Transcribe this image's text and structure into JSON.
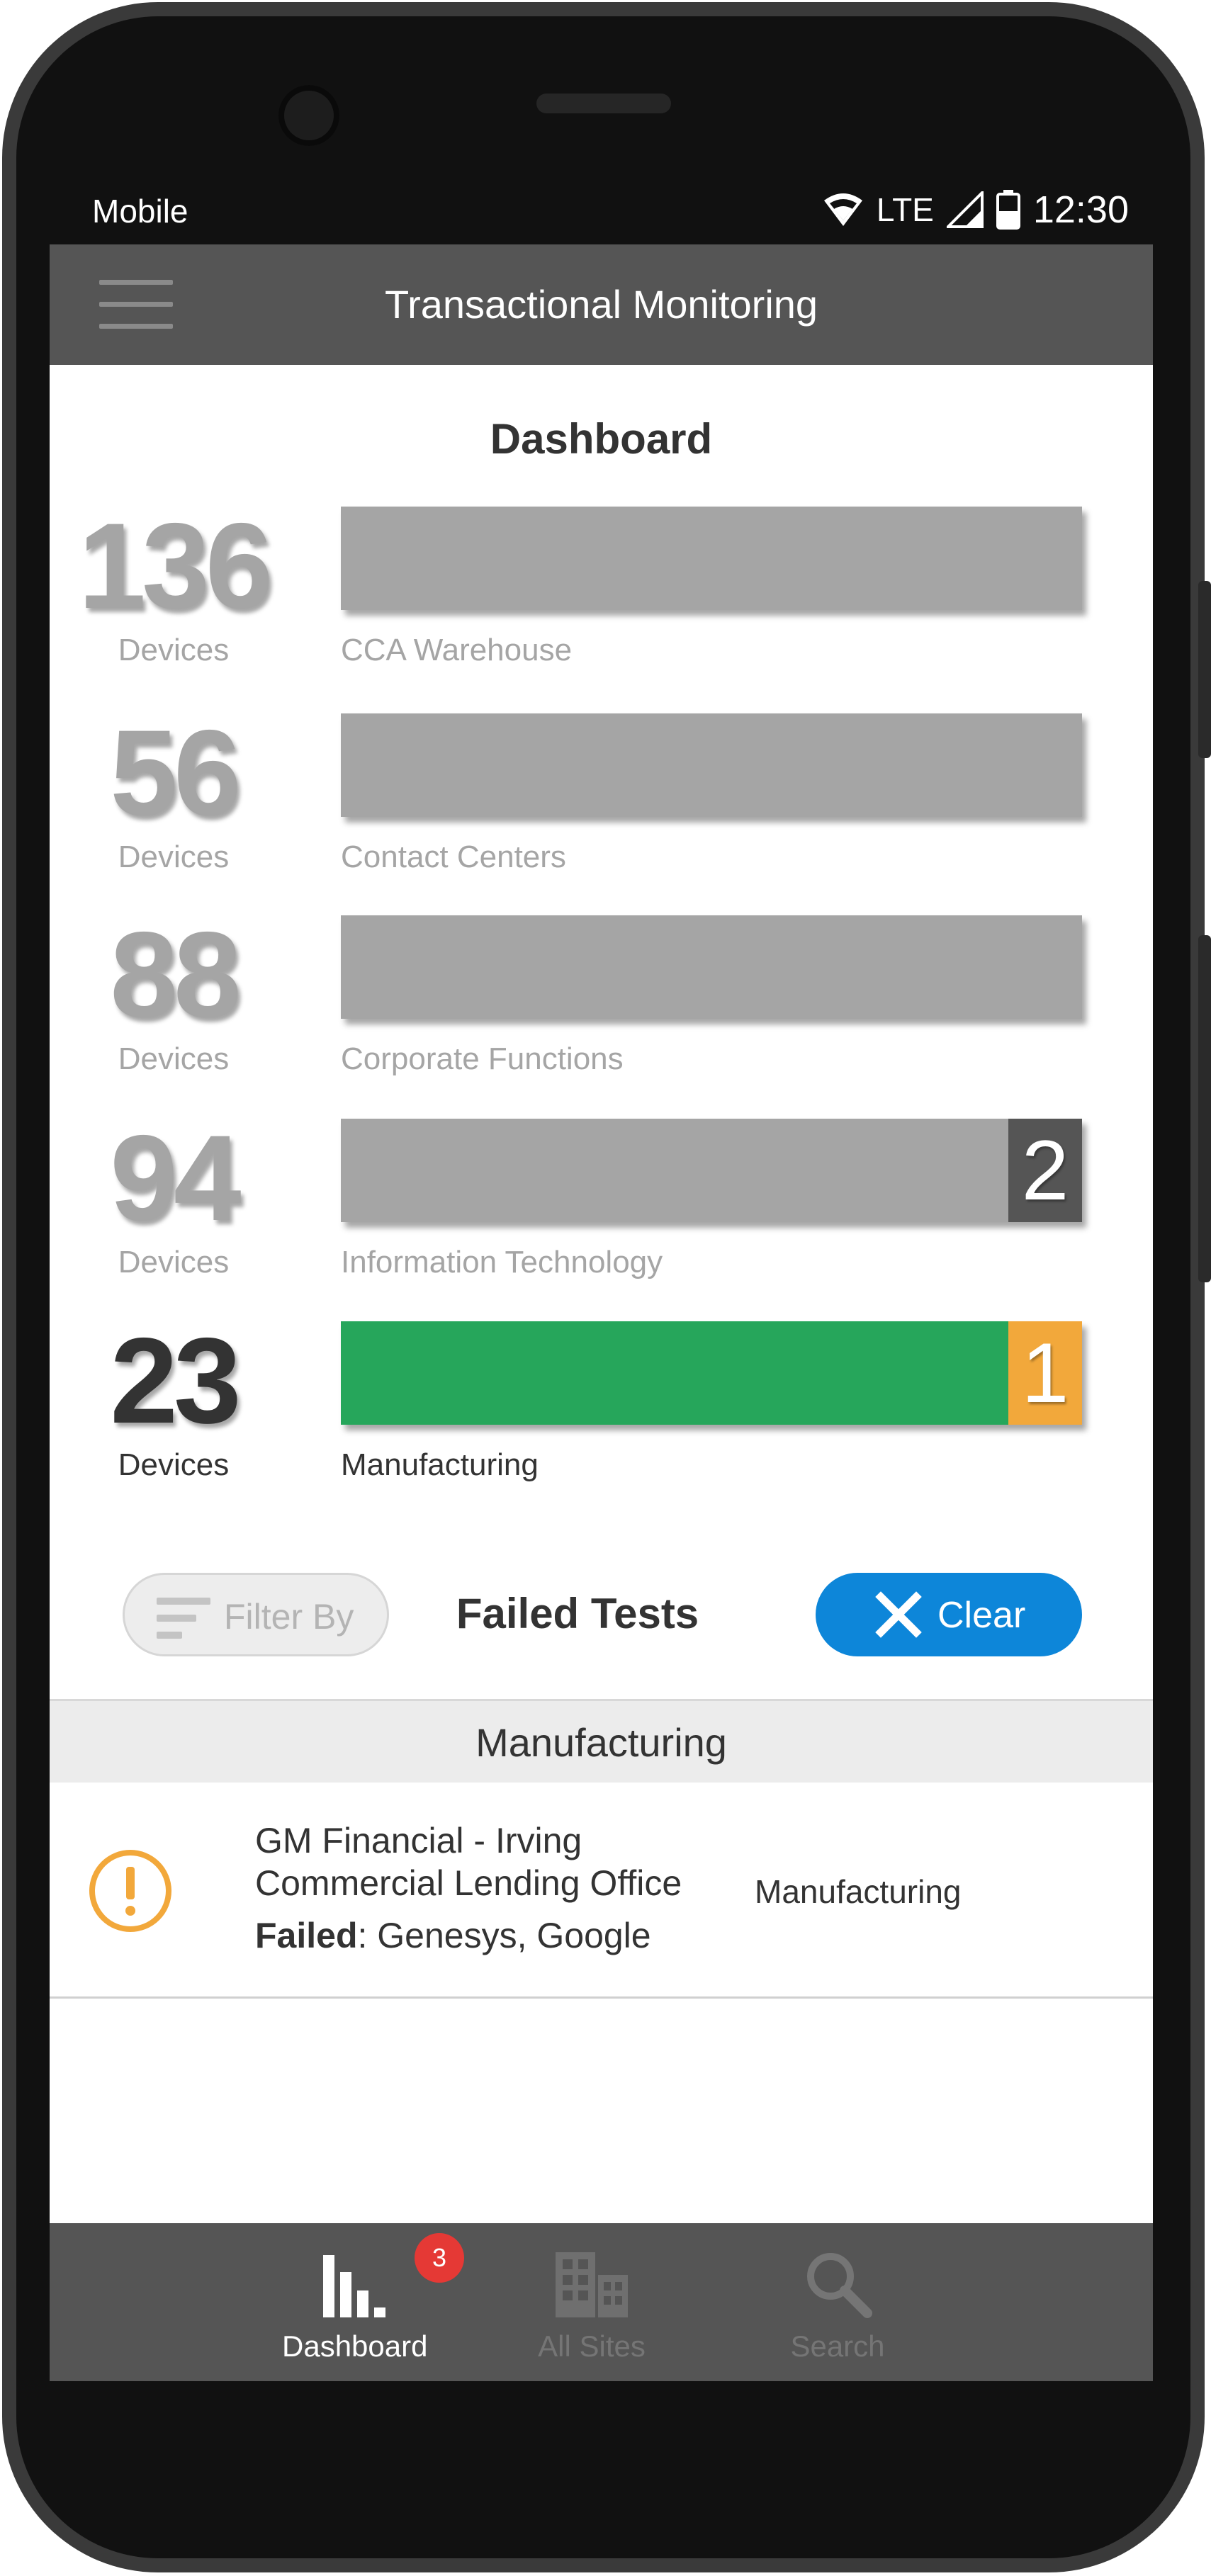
{
  "status_bar": {
    "carrier": "Mobile",
    "network": "LTE",
    "time": "12:30"
  },
  "app_bar": {
    "title": "Transactional Monitoring"
  },
  "dashboard": {
    "title": "Dashboard",
    "rows": [
      {
        "count": "136",
        "unit": "Devices",
        "category": "CCA Warehouse",
        "bar_color": "#a5a5a5",
        "badge": null,
        "fill_fraction": 1.0
      },
      {
        "count": "56",
        "unit": "Devices",
        "category": "Contact Centers",
        "bar_color": "#a5a5a5",
        "badge": null,
        "fill_fraction": 1.0
      },
      {
        "count": "88",
        "unit": "Devices",
        "category": "Corporate Functions",
        "bar_color": "#a5a5a5",
        "badge": null,
        "fill_fraction": 1.0
      },
      {
        "count": "94",
        "unit": "Devices",
        "category": "Information Technology",
        "bar_color": "#a5a5a5",
        "badge": "2",
        "badge_color": "#555555",
        "fill_fraction": 0.9
      },
      {
        "count": "23",
        "unit": "Devices",
        "category": "Manufacturing",
        "bar_color": "#26a65b",
        "badge": "1",
        "badge_color": "#f2a83b",
        "fill_fraction": 0.9
      }
    ]
  },
  "failed_tests": {
    "filter_label": "Filter By",
    "title": "Failed Tests",
    "clear_label": "Clear",
    "section": "Manufacturing",
    "results": [
      {
        "site_line1": "GM Financial - Irving",
        "site_line2": "Commercial Lending Office",
        "failed_prefix": "Failed",
        "failed_value": ": Genesys, Google",
        "category": "Manufacturing"
      }
    ]
  },
  "bottom_nav": {
    "items": [
      {
        "label": "Dashboard",
        "icon": "bar-chart-icon",
        "active": true,
        "badge": "3"
      },
      {
        "label": "All Sites",
        "icon": "buildings-icon",
        "active": false
      },
      {
        "label": "Search",
        "icon": "search-icon",
        "active": false
      }
    ]
  },
  "colors": {
    "accent_blue": "#0d86d9",
    "success_green": "#26a65b",
    "warning_orange": "#f2a83b",
    "appbar_gray": "#555555"
  }
}
